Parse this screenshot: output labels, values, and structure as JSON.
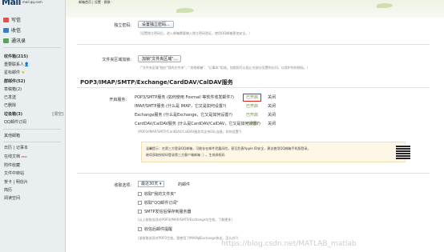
{
  "header": {
    "logo_text": "Mail",
    "logo_domain": "mail.qq.com",
    "top_links": "邮箱首页 | 设置 · 换肤 ·"
  },
  "sidebar": {
    "buttons": [
      {
        "label": "写信",
        "icon": "pencil-icon"
      },
      {
        "label": "收信",
        "icon": "inbox-icon"
      },
      {
        "label": "通讯录",
        "icon": "contacts-icon"
      }
    ],
    "folders": [
      {
        "label": "收件箱(215)",
        "bold": true
      },
      {
        "label": "重要联系人",
        "suffix": "👤"
      },
      {
        "label": "星标邮件",
        "suffix": "★"
      },
      {
        "label": "群邮件(52)",
        "bold": true
      },
      {
        "label": "草稿箱(2)"
      },
      {
        "label": "已发送"
      },
      {
        "label": "已删除"
      },
      {
        "label": "垃圾箱(3)",
        "extra": "[清空]"
      },
      {
        "label": "QQ邮件订阅"
      }
    ],
    "other_title": "其他邮箱",
    "apps": [
      {
        "label": "日历 | 记事本"
      },
      {
        "label": "在线文档",
        "badge": "NEW"
      },
      {
        "label": "附件收藏"
      },
      {
        "label": "文件中转站"
      },
      {
        "label": "贺卡 | 明信片"
      },
      {
        "label": "简历"
      },
      {
        "label": "阅读空间"
      }
    ]
  },
  "settings": {
    "independent_password": {
      "label": "独立密码:",
      "button": "设置独立密码...",
      "note": "（设置独立密码后，进入邮箱需要输入独立密码验证，使用QQ邮箱更加安全。）"
    },
    "folder_area": {
      "label": "文件夹区域加锁:",
      "button": "加锁\"文件夹区域\"...",
      "note": "（\"文件夹区域\"指在\"我的文件夹\"、\"其他邮箱\"、\"记事本\"组成。加锁即可以阻止对部分设置的访问，以保护你的隐私。）"
    },
    "section_title": "POP3/IMAP/SMTP/Exchange/CardDAV/CalDAV服务",
    "service_label": "开启服务:",
    "services": [
      {
        "name": "POP3/SMTP服务 (如何使用 Foxmail 等软件收发邮件?)",
        "status": "已开启",
        "action": "关闭"
      },
      {
        "name": "IMAP/SMTP服务 (什么是 IMAP，它又是如何设置?)",
        "status": "已开启",
        "action": "关闭"
      },
      {
        "name": "Exchange服务 (什么是Exchange，它又是如何设置?)",
        "status": "已开启",
        "action": "关闭"
      },
      {
        "name": "CardDAV/CalDAV服务 (什么是CardDAV/CalDAV，它又是如何设置?)",
        "status": "已开启",
        "action": "关闭"
      }
    ],
    "services_note": "(POP3/IMAP/SMTP/CardDAV/CalDAV服务均支持SSL连接。如何设置?)",
    "alert": {
      "line1": "温馨提示：在第三方登录QQ邮箱，可能存在邮件泄露风险，甚至危害Apple ID安全，建议使用QQ邮箱手机版登录。",
      "line2": "继续获取授权码登录第三方客户端邮箱 ⓘ 。生成授权码"
    },
    "receive": {
      "label": "收取选项:",
      "select": "最近30天",
      "select_suffix": "的邮件",
      "options": [
        "收取\"我的文件夹\"",
        "收取\"QQ邮件订阅\"",
        "SMTP发信后保存到服务器"
      ],
      "options_note": "(以上收取选项对POP3/IMAP/SMTP/Exchange均生效。了解更多)",
      "last_option": "收信后邮件提醒",
      "last_note": "(该收取选项对POP3生效。我使用了IMAP或Exchange协议，怎么办?)"
    }
  },
  "watermark": "https://blog.csdn.net/MATLAB_matlab"
}
